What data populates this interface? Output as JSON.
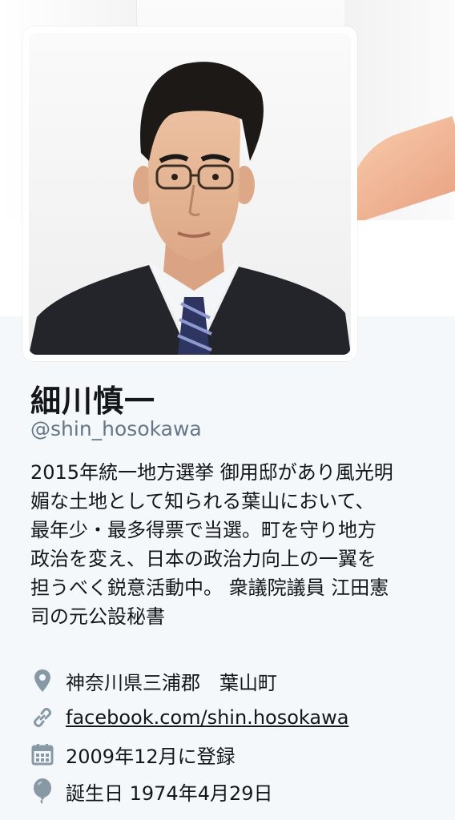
{
  "profile": {
    "name": "細川慎一",
    "handle": "@shin_hosokawa",
    "bio": "2015年統一地方選挙 御用邸があり風光明\n媚な土地として知られる葉山において、\n最年少・最多得票で当選。町を守り地方\n政治を変え、日本の政治力向上の一翼を\n担うべく鋭意活動中。 衆議院議員 江田憲\n司の元公設秘書",
    "location": "神奈川県三浦郡　葉山町",
    "website": "facebook.com/shin.hosokawa",
    "joined": "2009年12月に登録",
    "birthday": "誕生日 1974年4月29日"
  },
  "icons": {
    "location": "location-pin-icon",
    "website": "link-icon",
    "joined": "calendar-icon",
    "birthday": "balloon-icon"
  },
  "colors": {
    "background": "#f5f8fa",
    "text": "#14171a",
    "secondary": "#657786",
    "icon": "#8899a6"
  }
}
